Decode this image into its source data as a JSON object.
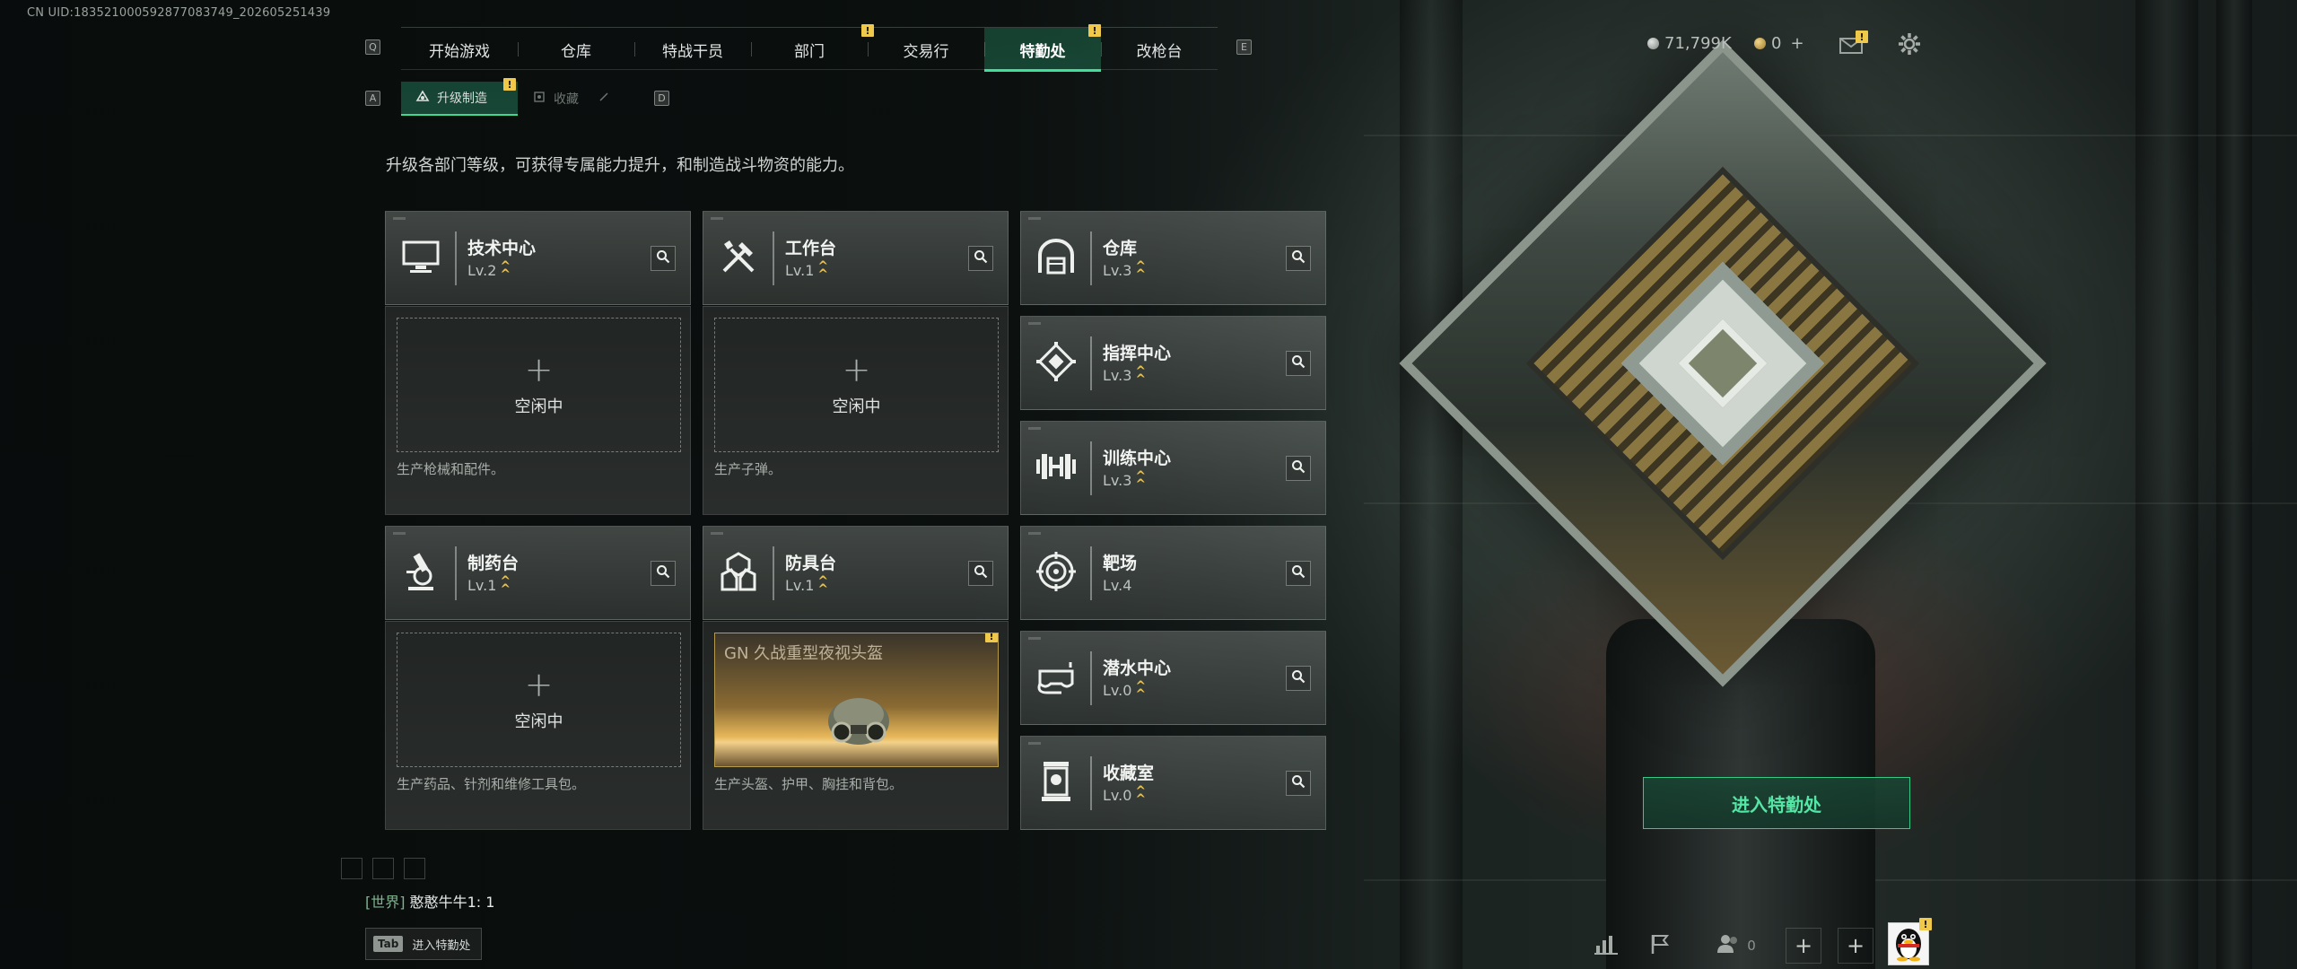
{
  "uid": "CN UID:18352100059287708374​9_202605251439",
  "nav": {
    "key_left": "Q",
    "key_right": "E",
    "tabs": [
      {
        "label": "开始游戏",
        "badge": "",
        "active": false
      },
      {
        "label": "仓库",
        "badge": "",
        "active": false
      },
      {
        "label": "特战干员",
        "badge": "",
        "active": false
      },
      {
        "label": "部门",
        "badge": "!",
        "active": false
      },
      {
        "label": "交易行",
        "badge": "",
        "active": false
      },
      {
        "label": "特勤处",
        "badge": "!",
        "active": true
      },
      {
        "label": "改枪台",
        "badge": "",
        "active": false
      }
    ]
  },
  "subnav": {
    "key_left": "A",
    "key_right": "D",
    "items": [
      {
        "label": "升级制造",
        "badge": "!",
        "active": true
      },
      {
        "label": "收藏",
        "active": false
      }
    ]
  },
  "currency": {
    "primary": "71,799K",
    "secondary": "0",
    "plus": "+",
    "mail_badge": "!"
  },
  "description": "升级各部门等级，可获得专属能力提升，和制造战斗物资的能力。",
  "facilities": [
    {
      "name": "技术中心",
      "level": "Lv.2",
      "upgrade": true,
      "icon": "monitor-icon"
    },
    {
      "name": "工作台",
      "level": "Lv.1",
      "upgrade": true,
      "icon": "tools-icon"
    },
    {
      "name": "仓库",
      "level": "Lv.3",
      "upgrade": true,
      "icon": "warehouse-icon"
    },
    {
      "name": "指挥中心",
      "level": "Lv.3",
      "upgrade": true,
      "icon": "command-icon"
    },
    {
      "name": "训练中心",
      "level": "Lv.3",
      "upgrade": true,
      "icon": "dumbbell-icon"
    },
    {
      "name": "制药台",
      "level": "Lv.1",
      "upgrade": true,
      "icon": "microscope-icon"
    },
    {
      "name": "防具台",
      "level": "Lv.1",
      "upgrade": true,
      "icon": "armor-icon"
    },
    {
      "name": "靶场",
      "level": "Lv.4",
      "upgrade": false,
      "icon": "target-icon"
    },
    {
      "name": "潜水中心",
      "level": "Lv.0",
      "upgrade": true,
      "icon": "diving-mask-icon"
    },
    {
      "name": "收藏室",
      "level": "Lv.0",
      "upgrade": true,
      "icon": "trophy-icon"
    }
  ],
  "production": [
    {
      "status": "空闲中",
      "description": "生产枪械和配件。"
    },
    {
      "status": "空闲中",
      "description": "生产子弹。"
    },
    {
      "status": "空闲中",
      "description": "生产药品、针剂和维修工具包。"
    },
    {
      "item": "GN 久战重型夜视头盔",
      "badge": "!",
      "description": "生产头盔、护甲、胸挂和背包。"
    }
  ],
  "enter_button": "进入特勤处",
  "chat": {
    "channel": "[世界]",
    "sender": "憨憨牛牛1",
    "message": "1"
  },
  "tab_hint": {
    "key": "Tab",
    "label": "进入特勤处"
  },
  "bottom": {
    "friends_count": "0",
    "avatar_badge": "!"
  },
  "colors": {
    "accent": "#3fe09a",
    "badge": "#f0c94a",
    "upgrade": "#e8c24e"
  }
}
